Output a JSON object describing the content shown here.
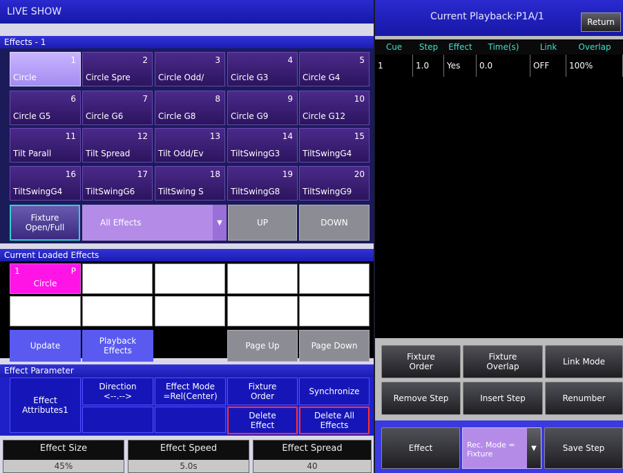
{
  "left": {
    "title": "LIVE SHOW",
    "effects_header": "Effects - 1",
    "effects": [
      {
        "num": "1",
        "label": "Circle"
      },
      {
        "num": "2",
        "label": "Circle Spre"
      },
      {
        "num": "3",
        "label": "Circle Odd/"
      },
      {
        "num": "4",
        "label": "Circle G3"
      },
      {
        "num": "5",
        "label": "Circle G4"
      },
      {
        "num": "6",
        "label": "Circle G5"
      },
      {
        "num": "7",
        "label": "Circle G6"
      },
      {
        "num": "8",
        "label": "Circle G8"
      },
      {
        "num": "9",
        "label": "Circle G9"
      },
      {
        "num": "10",
        "label": "Circle G12"
      },
      {
        "num": "11",
        "label": "Tilt Parall"
      },
      {
        "num": "12",
        "label": "Tilt Spread"
      },
      {
        "num": "13",
        "label": "Tilt Odd/Ev"
      },
      {
        "num": "14",
        "label": "TiltSwingG3"
      },
      {
        "num": "15",
        "label": "TiltSwingG4"
      },
      {
        "num": "16",
        "label": "TiltSwingG4"
      },
      {
        "num": "17",
        "label": "TiltSwingG6"
      },
      {
        "num": "18",
        "label": "TiltSwing S"
      },
      {
        "num": "19",
        "label": "TiltSwingG8"
      },
      {
        "num": "20",
        "label": "TiltSwingG9"
      }
    ],
    "fixture_open_full": "Fixture Open/Full",
    "all_effects": "All Effects",
    "up": "UP",
    "down": "DOWN",
    "loaded_header": "Current Loaded Effects",
    "loaded_first": {
      "num": "1",
      "flag": "P",
      "label": "Circle"
    },
    "update": "Update",
    "playback_effects": "Playback Effects",
    "page_up": "Page Up",
    "page_down": "Page Down",
    "param_header": "Effect Parameter",
    "effect_attributes": "Effect Attributes1",
    "direction": "Direction",
    "direction_value": "<--.-->",
    "effect_mode": "Effect Mode",
    "effect_mode_value": "=Rel(Center)",
    "fixture_order": "Fixture Order",
    "synchronize": "Synchronize",
    "delete_effect": "Delete Effect",
    "delete_all_effects": "Delete All Effects",
    "effect_size_label": "Effect Size",
    "effect_size_value": "45%",
    "effect_speed_label": "Effect Speed",
    "effect_speed_value": "5.0s",
    "effect_spread_label": "Effect Spread",
    "effect_spread_value": "40"
  },
  "right": {
    "title": "Current Playback:P1A/1",
    "return": "Return",
    "columns": [
      "Cue",
      "Step",
      "Effect",
      "Time(s)",
      "Link",
      "Overlap"
    ],
    "rows": [
      [
        "1",
        "1.0",
        "Yes",
        "0.0",
        "OFF",
        "100%"
      ]
    ],
    "fixture_order": "Fixture Order",
    "fixture_overlap": "Fixture Overlap",
    "link_mode": "Link Mode",
    "remove_step": "Remove Step",
    "insert_step": "Insert Step",
    "renumber": "Renumber",
    "effect": "Effect",
    "rec_mode": "Rec. Mode = Fixture",
    "save_step": "Save Step"
  },
  "colors": {
    "title_blue": "#1a1ab0",
    "selected_effect": "#b8a4ff",
    "loaded_magenta": "#ff14e6",
    "header_cyan": "#3de0d0",
    "delete_red": "#ff3030"
  }
}
